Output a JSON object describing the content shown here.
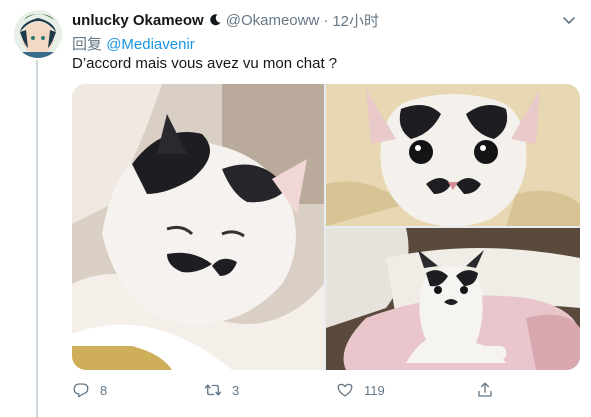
{
  "tweet": {
    "display_name": "unlucky Okameow",
    "handle": "@Okameoww",
    "separator": "·",
    "time": "12小时",
    "reply_prefix": "回复",
    "reply_to": "@Mediavenir",
    "text": "D’accord mais vous avez vu mon chat ?"
  },
  "actions": {
    "reply_count": "8",
    "retweet_count": "3",
    "like_count": "119",
    "share_count": ""
  },
  "colors": {
    "link": "#1b95e0",
    "muted": "#657786",
    "text": "#14171a",
    "line": "#ccd6dd"
  },
  "icons": [
    "moon-icon",
    "chevron-down-icon",
    "reply-icon",
    "retweet-icon",
    "like-icon",
    "share-icon"
  ]
}
